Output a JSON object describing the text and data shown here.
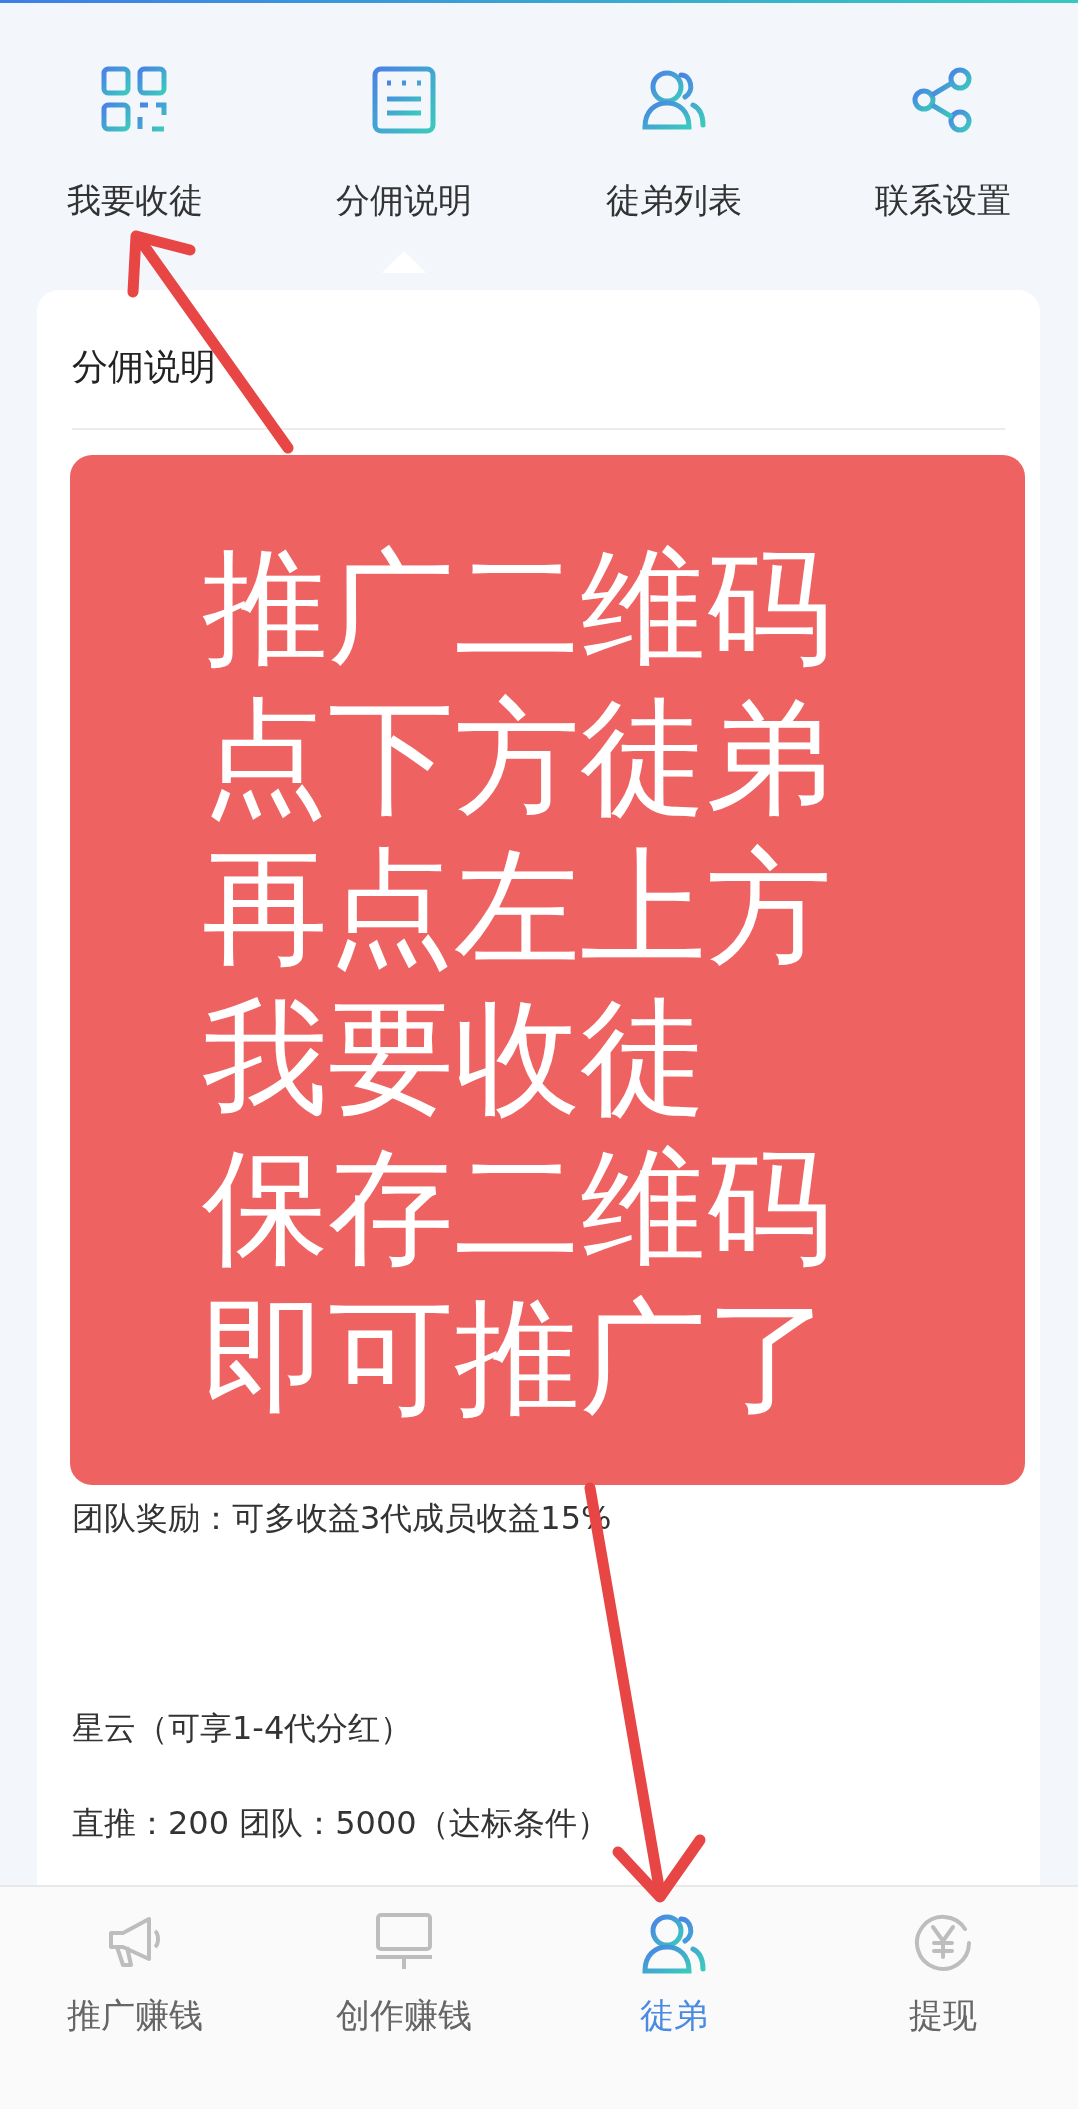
{
  "top_menu": [
    {
      "label": "我要收徒",
      "selected": false
    },
    {
      "label": "分佣说明",
      "selected": true
    },
    {
      "label": "徒弟列表",
      "selected": false
    },
    {
      "label": "联系设置",
      "selected": false
    }
  ],
  "card": {
    "title": "分佣说明",
    "sections": [
      {
        "lines": [
          "团队奖励：可多收益3代成员收益15%"
        ]
      },
      {
        "lines": [
          "星云（可享1-4代分红）",
          "直推：200 团队：5000（达标条件）"
        ]
      }
    ]
  },
  "annotation": {
    "lines": [
      "推广二维码",
      "点下方徒弟",
      "再点左上方",
      "我要收徒",
      "保存二维码",
      "即可推广了"
    ]
  },
  "bottom_nav": [
    {
      "label": "推广赚钱",
      "selected": false
    },
    {
      "label": "创作赚钱",
      "selected": false
    },
    {
      "label": "徒弟",
      "selected": true
    },
    {
      "label": "提现",
      "selected": false
    }
  ]
}
